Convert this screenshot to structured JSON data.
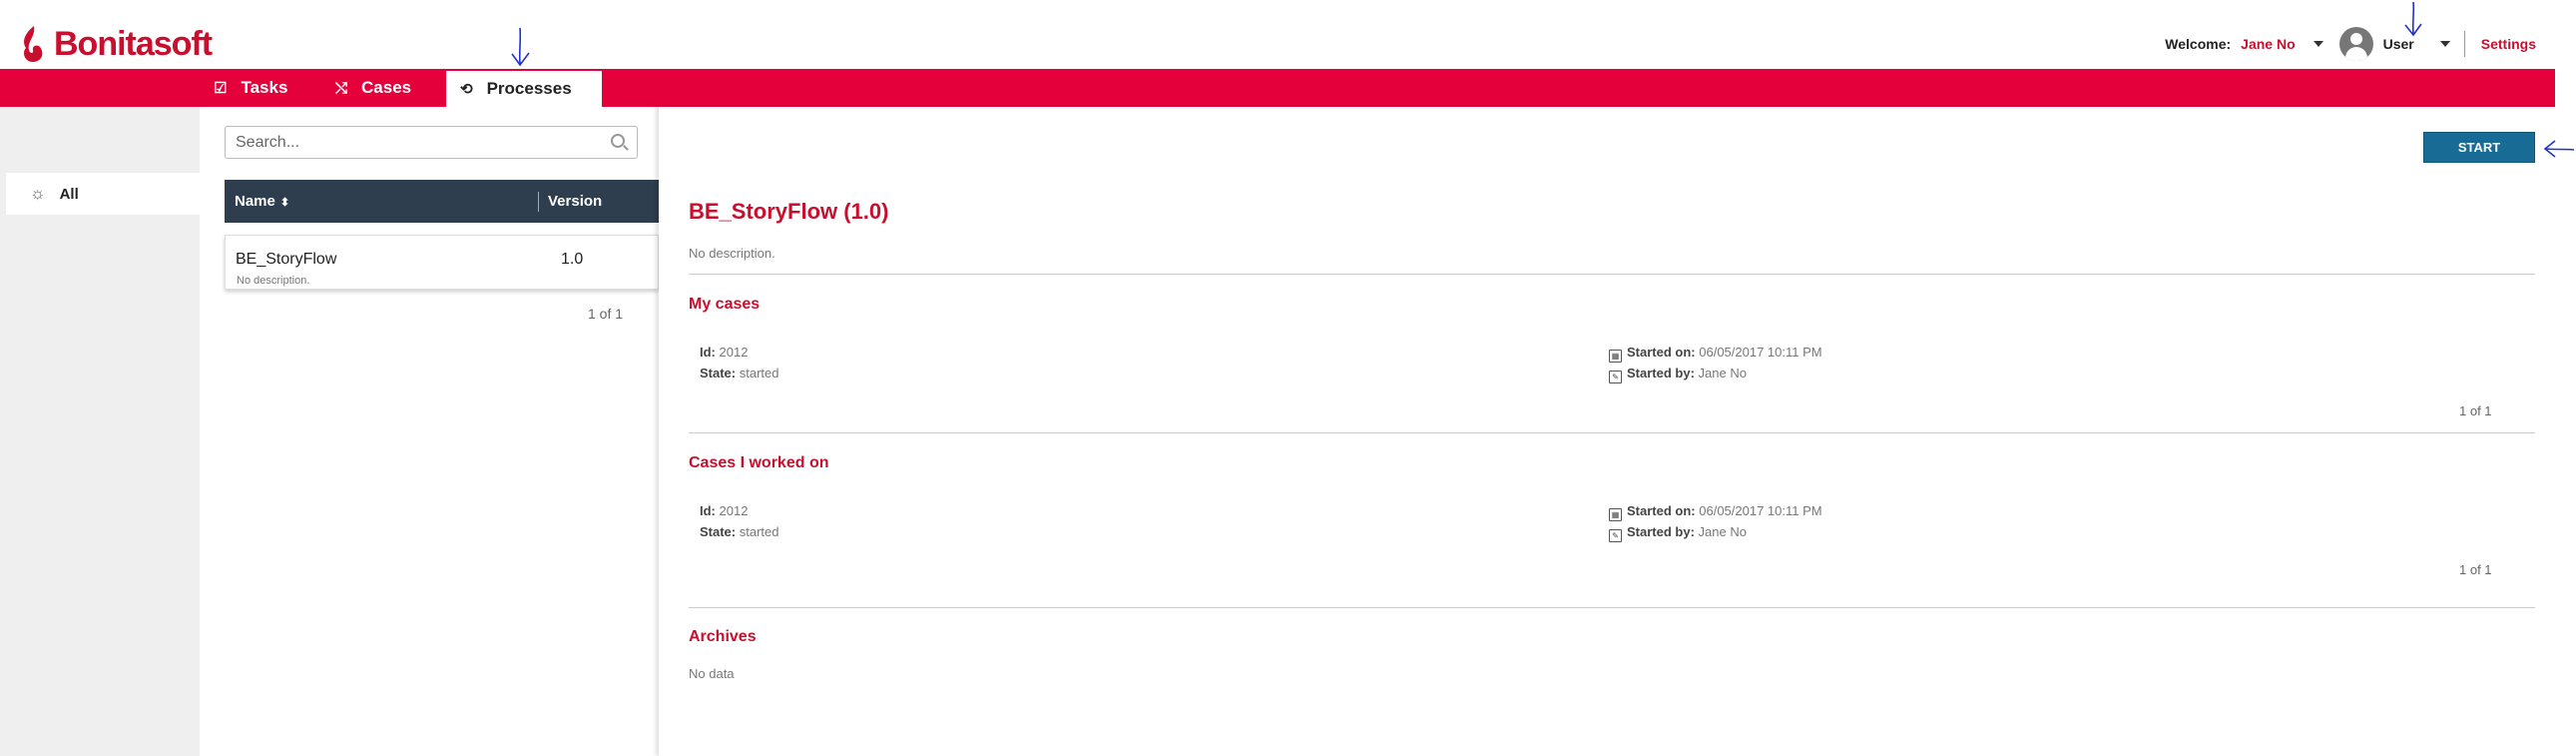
{
  "app": {
    "brand": "Bonitasoft",
    "brand_color": "#c8102e",
    "nav_color": "#e4003a"
  },
  "header": {
    "welcome_label": "Welcome:",
    "user_name": "Jane No",
    "profile": "User",
    "settings": "Settings"
  },
  "nav": {
    "tabs": [
      {
        "label": "Tasks",
        "icon": "checkbox-icon",
        "active": false
      },
      {
        "label": "Cases",
        "icon": "shuffle-icon",
        "active": false
      },
      {
        "label": "Processes",
        "icon": "sync-icon",
        "active": true
      }
    ]
  },
  "sidebar": {
    "items": [
      {
        "label": "All",
        "icon": "sun-icon",
        "selected": true
      }
    ]
  },
  "list": {
    "search_placeholder": "Search...",
    "columns": [
      {
        "label": "Name",
        "sort_icon": "sort-icon"
      },
      {
        "label": "Version"
      }
    ],
    "rows": [
      {
        "name": "BE_StoryFlow",
        "description": "No description.",
        "version": "1.0"
      }
    ],
    "pager": "1 of 1"
  },
  "detail": {
    "start_label": "START",
    "start_color": "#176b94",
    "title": "BE_StoryFlow (1.0)",
    "description": "No description.",
    "sections": [
      {
        "title": "My cases",
        "id_label": "Id:",
        "id": "2012",
        "state_label": "State:",
        "state": "started",
        "started_on_label": "Started on:",
        "started_on": "06/05/2017 10:11 PM",
        "started_by_label": "Started by:",
        "started_by": "Jane No",
        "pager": "1 of 1"
      },
      {
        "title": "Cases I worked on",
        "id_label": "Id:",
        "id": "2012",
        "state_label": "State:",
        "state": "started",
        "started_on_label": "Started on:",
        "started_on": "06/05/2017 10:11 PM",
        "started_by_label": "Started by:",
        "started_by": "Jane No",
        "pager": "1 of 1"
      }
    ],
    "archives": {
      "title": "Archives",
      "empty": "No data"
    }
  }
}
